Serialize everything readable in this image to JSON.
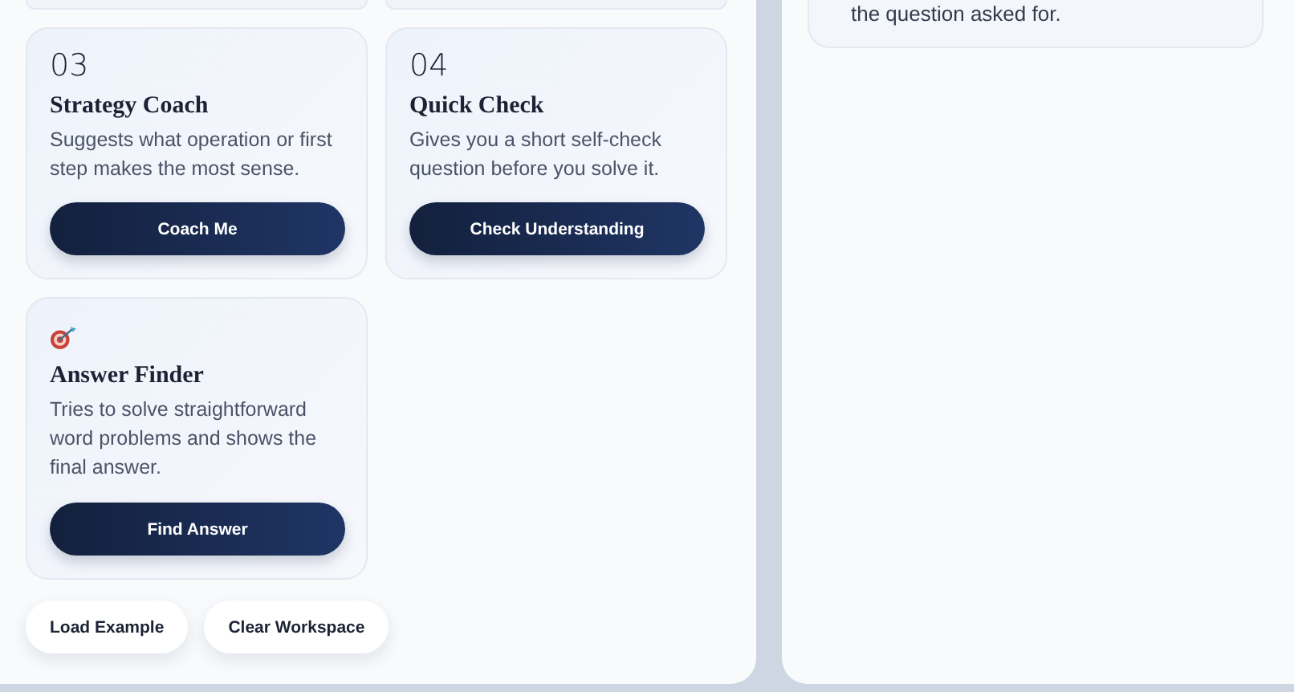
{
  "tools": [
    {
      "kind": "number",
      "number": "03",
      "title": "Strategy Coach",
      "description": "Suggests what operation or first step makes the most sense.",
      "button": "Coach Me"
    },
    {
      "kind": "number",
      "number": "04",
      "title": "Quick Check",
      "description": "Gives you a short self-check question before you solve it.",
      "button": "Check Understanding"
    },
    {
      "kind": "icon",
      "title": "Answer Finder",
      "description": "Tries to solve straightforward word problems and shows the final answer.",
      "button": "Find Answer"
    }
  ],
  "actions": [
    "Load Example",
    "Clear Workspace"
  ],
  "side_panel": {
    "card_text": "the question asked for."
  }
}
